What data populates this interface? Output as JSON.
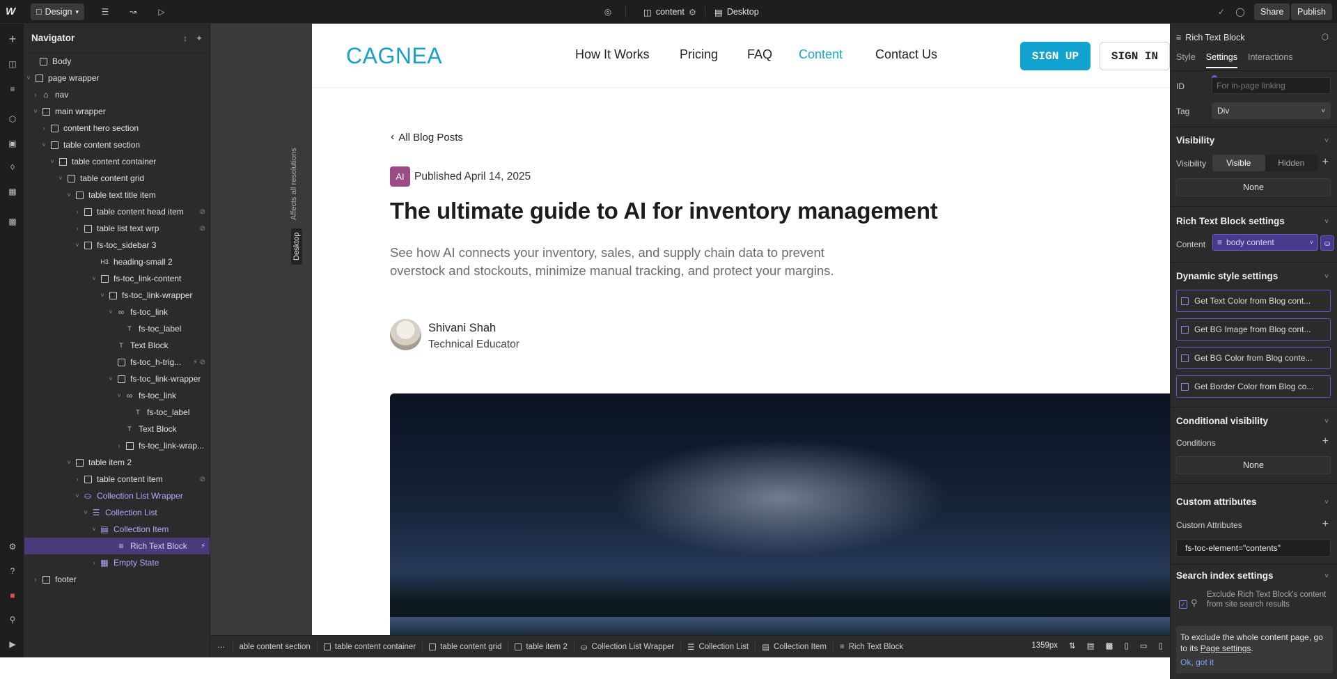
{
  "topbar": {
    "mode_label": "Design",
    "page_name": "content",
    "breakpoint_label": "Desktop",
    "share_label": "Share",
    "publish_label": "Publish"
  },
  "navigator": {
    "title": "Navigator",
    "items": [
      {
        "label": "Body"
      },
      {
        "label": "page wrapper"
      },
      {
        "label": "nav"
      },
      {
        "label": "main wrapper"
      },
      {
        "label": "content hero section"
      },
      {
        "label": "table content section"
      },
      {
        "label": "table content container"
      },
      {
        "label": "table content grid"
      },
      {
        "label": "table text title item"
      },
      {
        "label": "table content head item"
      },
      {
        "label": "table list text wrp"
      },
      {
        "label": "fs-toc_sidebar 3"
      },
      {
        "label": "heading-small 2"
      },
      {
        "label": "fs-toc_link-content"
      },
      {
        "label": "fs-toc_link-wrapper"
      },
      {
        "label": "fs-toc_link"
      },
      {
        "label": "fs-toc_label"
      },
      {
        "label": "Text Block"
      },
      {
        "label": "fs-toc_h-trig..."
      },
      {
        "label": "fs-toc_link-wrapper"
      },
      {
        "label": "fs-toc_link"
      },
      {
        "label": "fs-toc_label"
      },
      {
        "label": "Text Block"
      },
      {
        "label": "fs-toc_link-wrap..."
      },
      {
        "label": "table item 2"
      },
      {
        "label": "table content item"
      },
      {
        "label": "Collection List Wrapper"
      },
      {
        "label": "Collection List"
      },
      {
        "label": "Collection Item"
      },
      {
        "label": "Rich Text Block"
      },
      {
        "label": "Empty State"
      },
      {
        "label": "footer"
      }
    ]
  },
  "canvas": {
    "affects_label": "Affects all resolutions",
    "desktop_label": "Desktop"
  },
  "site": {
    "logo": "CAGNEA",
    "nav_links": [
      "How It Works",
      "Pricing",
      "FAQ",
      "Content",
      "Contact Us"
    ],
    "signup_label": "SIGN UP",
    "signin_label": "SIGN IN",
    "back_link": "All Blog Posts",
    "badge": "AI",
    "published": "Published April 14, 2025",
    "title": "The ultimate guide to AI for inventory management",
    "subtitle": "See how AI connects your inventory, sales, and supply chain data to prevent overstock and stockouts, minimize manual tracking, and protect your margins.",
    "author_name": "Shivani Shah",
    "author_role": "Technical Educator"
  },
  "breadcrumbs": {
    "items": [
      "able content section",
      "table content container",
      "table content grid",
      "table item 2",
      "Collection List Wrapper",
      "Collection List",
      "Collection Item",
      "Rich Text Block"
    ],
    "width_readout": "1359px"
  },
  "panel": {
    "element_name": "Rich Text Block",
    "tabs": [
      "Style",
      "Settings",
      "Interactions"
    ],
    "id_label": "ID",
    "id_placeholder": "For in-page linking",
    "tag_label": "Tag",
    "tag_value": "Div",
    "visibility_section": "Visibility",
    "visibility_label": "Visibility",
    "visible_option": "Visible",
    "hidden_option": "Hidden",
    "none_1": "None",
    "rtb_section": "Rich Text Block settings",
    "content_label": "Content",
    "content_value": "body content",
    "dynamic_section": "Dynamic style settings",
    "dynamic_items": [
      "Get Text Color from  Blog cont...",
      "Get BG Image from  Blog cont...",
      "Get BG Color from  Blog conte...",
      "Get Border Color from  Blog co..."
    ],
    "conditional_section": "Conditional visibility",
    "conditions_label": "Conditions",
    "none_2": "None",
    "custom_attr_section": "Custom attributes",
    "custom_attr_label": "Custom Attributes",
    "custom_attr_value": "fs-toc-element=\"contents\"",
    "search_section": "Search index settings",
    "exclude_text": "Exclude Rich Text Block's content from site search results",
    "tip_text_before": "To exclude the whole content page, go to its ",
    "tip_link": "Page settings",
    "tip_text_after": ".",
    "tip_ok": "Ok, got it"
  },
  "colors": {
    "accent_purple": "#6a57c9",
    "brand_teal": "#12a2cf",
    "selection": "#4a3a7a"
  }
}
